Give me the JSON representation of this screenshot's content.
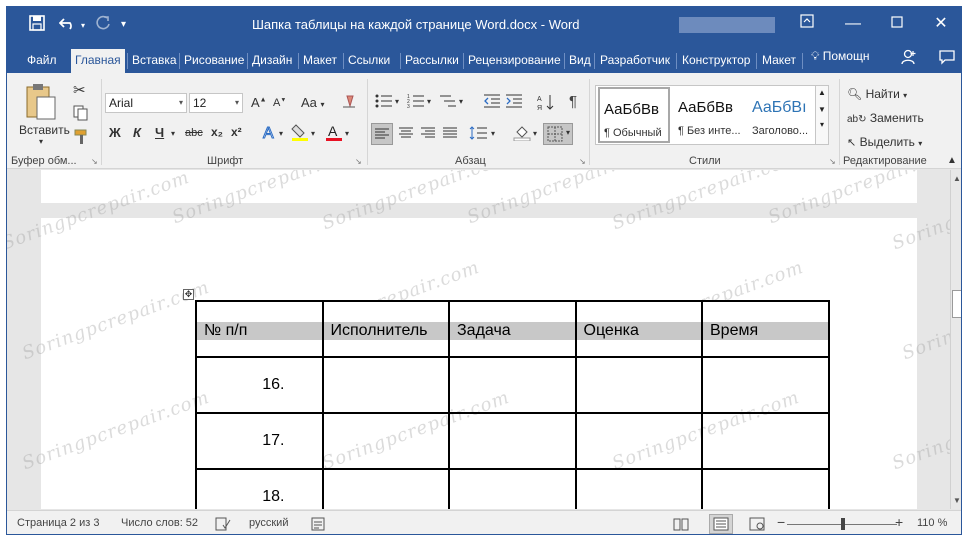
{
  "titlebar": {
    "title": "Шапка таблицы на каждой странице Word.docx  -  Word",
    "save_icon": "save-icon",
    "undo_icon": "undo-icon",
    "redo_icon": "redo-icon",
    "customize_icon": "customize-qat-icon"
  },
  "tabs": [
    {
      "label": "Файл"
    },
    {
      "label": "Главная"
    },
    {
      "label": "Вставка"
    },
    {
      "label": "Рисование"
    },
    {
      "label": "Дизайн"
    },
    {
      "label": "Макет"
    },
    {
      "label": "Ссылки"
    },
    {
      "label": "Рассылки"
    },
    {
      "label": "Рецензирование"
    },
    {
      "label": "Вид"
    },
    {
      "label": "Разработчик"
    },
    {
      "label": "Конструктор"
    },
    {
      "label": "Макет"
    }
  ],
  "help": "Помощн",
  "ribbon": {
    "clipboard": {
      "paste_label": "Вставить",
      "group_label": "Буфер обм..."
    },
    "font": {
      "font_name": "Arial",
      "font_size": "12",
      "group_label": "Шрифт",
      "bold": "Ж",
      "italic": "К",
      "underline": "Ч",
      "strike": "abc",
      "sub": "x₂",
      "sup": "x²",
      "grow": "A",
      "shrink": "A",
      "case": "Aa"
    },
    "paragraph": {
      "group_label": "Абзац"
    },
    "styles": {
      "group_label": "Стили",
      "items": [
        {
          "preview": "АаБбВв",
          "name": "¶ Обычный"
        },
        {
          "preview": "АаБбВв",
          "name": "¶ Без инте..."
        },
        {
          "preview": "АаБбВı",
          "name": "Заголово..."
        }
      ]
    },
    "editing": {
      "group_label": "Редактирование",
      "find": "Найти",
      "replace": "Заменить",
      "select": "Выделить"
    }
  },
  "document": {
    "watermark": "Soringpcrepair.com",
    "table": {
      "headers": [
        "№ п/п",
        "Исполнитель",
        "Задача",
        "Оценка",
        "Время"
      ],
      "rows": [
        [
          "16.",
          "",
          "",
          "",
          ""
        ],
        [
          "17.",
          "",
          "",
          "",
          ""
        ],
        [
          "18.",
          "",
          "",
          "",
          ""
        ]
      ]
    }
  },
  "status": {
    "page": "Страница 2 из 3",
    "words": "Число слов: 52",
    "language": "русский",
    "zoom": "110 %",
    "zoom_level_percent": 110
  },
  "colors": {
    "accent": "#2b579a",
    "ribbon_bg": "#f1f1f1",
    "doc_bg": "#e6e6e6",
    "header_shade": "#c8c8c8"
  }
}
